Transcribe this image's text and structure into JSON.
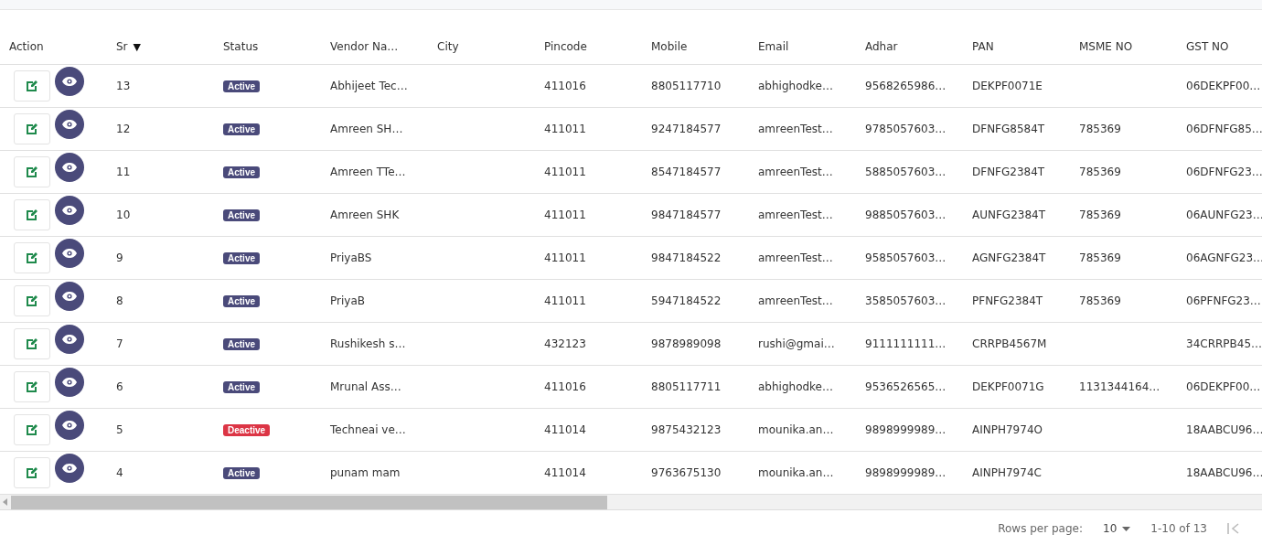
{
  "table": {
    "columns": [
      {
        "label": "Action"
      },
      {
        "label": "Sr",
        "sort": "▼"
      },
      {
        "label": "Status"
      },
      {
        "label": "Vendor Na…"
      },
      {
        "label": "City"
      },
      {
        "label": "Pincode"
      },
      {
        "label": "Mobile"
      },
      {
        "label": "Email"
      },
      {
        "label": "Adhar"
      },
      {
        "label": "PAN"
      },
      {
        "label": "MSME NO"
      },
      {
        "label": "GST NO"
      }
    ],
    "rows": [
      {
        "color": "#4a4a7a",
        "cells": [
          "",
          "13",
          "Active",
          "Abhijeet Tec…",
          "",
          "411016",
          "8805117710",
          "abhighodke…",
          "9568265986…",
          "DEKPF0071E",
          "",
          "06DEKPF00…"
        ]
      },
      {
        "color": "#4a4a7a",
        "cells": [
          "",
          "12",
          "Active",
          "Amreen SH…",
          "",
          "411011",
          "9247184577",
          "amreenTest…",
          "9785057603…",
          "DFNFG8584T",
          "785369",
          "06DFNFG85…"
        ]
      },
      {
        "color": "#4a4a7a",
        "cells": [
          "",
          "11",
          "Active",
          "Amreen TTe…",
          "",
          "411011",
          "8547184577",
          "amreenTest…",
          "5885057603…",
          "DFNFG2384T",
          "785369",
          "06DFNFG23…"
        ]
      },
      {
        "color": "#4a4a7a",
        "cells": [
          "",
          "10",
          "Active",
          "Amreen SHK",
          "",
          "411011",
          "9847184577",
          "amreenTest…",
          "9885057603…",
          "AUNFG2384T",
          "785369",
          "06AUNFG23…"
        ]
      },
      {
        "color": "#4a4a7a",
        "cells": [
          "",
          "9",
          "Active",
          "PriyaBS",
          "",
          "411011",
          "9847184522",
          "amreenTest…",
          "9585057603…",
          "AGNFG2384T",
          "785369",
          "06AGNFG23…"
        ]
      },
      {
        "color": "#4a4a7a",
        "cells": [
          "",
          "8",
          "Active",
          "PriyaB",
          "",
          "411011",
          "5947184522",
          "amreenTest…",
          "3585057603…",
          "PFNFG2384T",
          "785369",
          "06PFNFG23…"
        ]
      },
      {
        "color": "#4a4a7a",
        "cells": [
          "",
          "7",
          "Active",
          "Rushikesh s…",
          "",
          "432123",
          "9878989098",
          "rushi@gmai…",
          "9111111111…",
          "CRRPB4567M",
          "",
          "34CRRPB45…"
        ]
      },
      {
        "color": "#4a4a7a",
        "cells": [
          "",
          "6",
          "Active",
          "Mrunal Ass…",
          "",
          "411016",
          "8805117711",
          "abhighodke…",
          "9536526565…",
          "DEKPF0071G",
          "1131344164…",
          "06DEKPF00…"
        ]
      },
      {
        "color": "#dc3545",
        "cells": [
          "",
          "5",
          "Deactive",
          "Techneai ve…",
          "",
          "411014",
          "9875432123",
          "mounika.an…",
          "9898999989…",
          "AINPH7974O",
          "",
          "18AABCU96…"
        ]
      },
      {
        "color": "#4a4a7a",
        "cells": [
          "",
          "4",
          "Active",
          "punam mam",
          "",
          "411014",
          "9763675130",
          "mounika.an…",
          "9898999989…",
          "AINPH7974C",
          "",
          "18AABCU96…"
        ]
      }
    ]
  },
  "pagination": {
    "rows_per_page_label": "Rows per page:",
    "rows_per_page": "10",
    "range": "1-10 of 13"
  }
}
